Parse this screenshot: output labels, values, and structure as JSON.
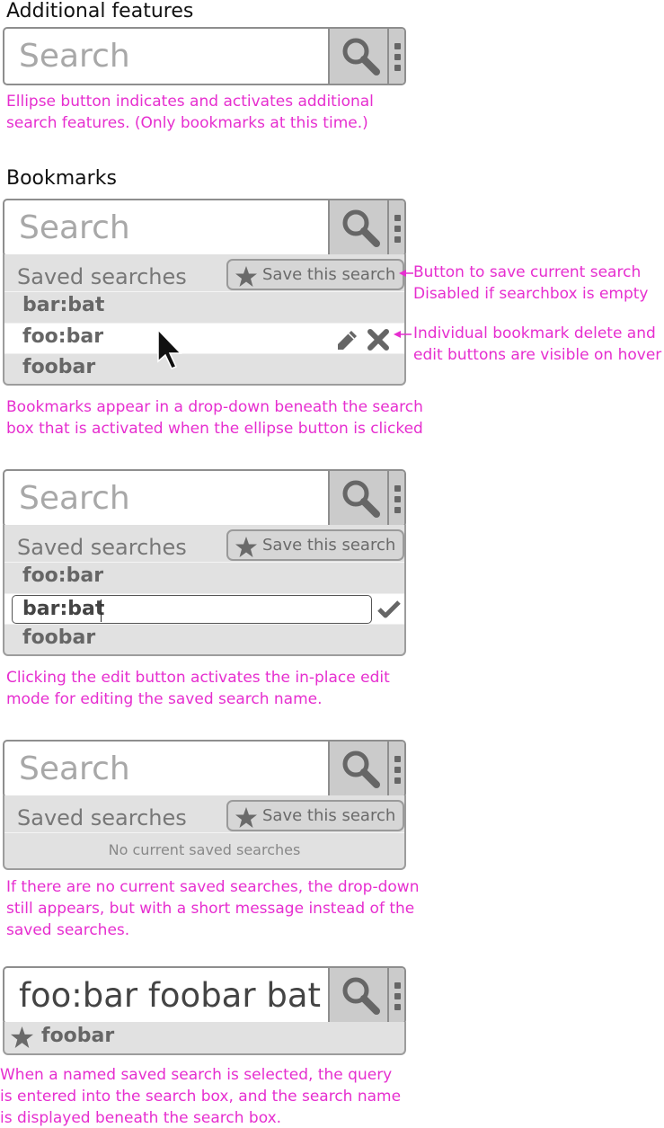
{
  "section_titles": {
    "additional": "Additional features",
    "bookmarks": "Bookmarks"
  },
  "search": {
    "placeholder": "Search",
    "filled_query": "foo:bar foobar bat"
  },
  "dropdown": {
    "header": "Saved searches",
    "save_button": "Save this search",
    "empty_message": "No current saved searches"
  },
  "panel_hover": {
    "items": [
      "bar:bat",
      "foo:bar",
      "foobar"
    ],
    "hovered": "foo:bar"
  },
  "panel_edit": {
    "items": [
      "foo:bar",
      "bar:bat",
      "foobar"
    ],
    "editing": "bar:bat"
  },
  "panel_named": {
    "selected_name": "foobar"
  },
  "notes": {
    "ellipse": [
      "Ellipse button indicates and activates additional",
      "search features. (Only bookmarks at this time.)"
    ],
    "save_btn": [
      "Button to save current search",
      "Disabled if searchbox is empty"
    ],
    "hover_btns": [
      "Individual bookmark delete and",
      "edit buttons are visible on hover"
    ],
    "dropdown": [
      "Bookmarks appear in a drop-down beneath the search",
      "box that is activated when the ellipse button is clicked"
    ],
    "edit": [
      "Clicking the edit button activates the in-place edit",
      "mode for editing the saved search name."
    ],
    "empty": [
      "If there are no current saved searches, the drop-down",
      "still appears, but with a short message instead of the",
      "saved searches."
    ],
    "named": [
      "When a named saved search is selected, the query",
      "is entered into the search box, and the search name",
      "is displayed beneath the search box."
    ]
  },
  "colors": {
    "annotation": "#e62ecf",
    "button_gray": "#cbcbcb",
    "panel_gray": "#e1e1e1"
  },
  "icons": [
    "search-icon",
    "ellipsis-icon",
    "star-icon",
    "pencil-icon",
    "close-icon",
    "check-icon",
    "cursor-icon"
  ]
}
